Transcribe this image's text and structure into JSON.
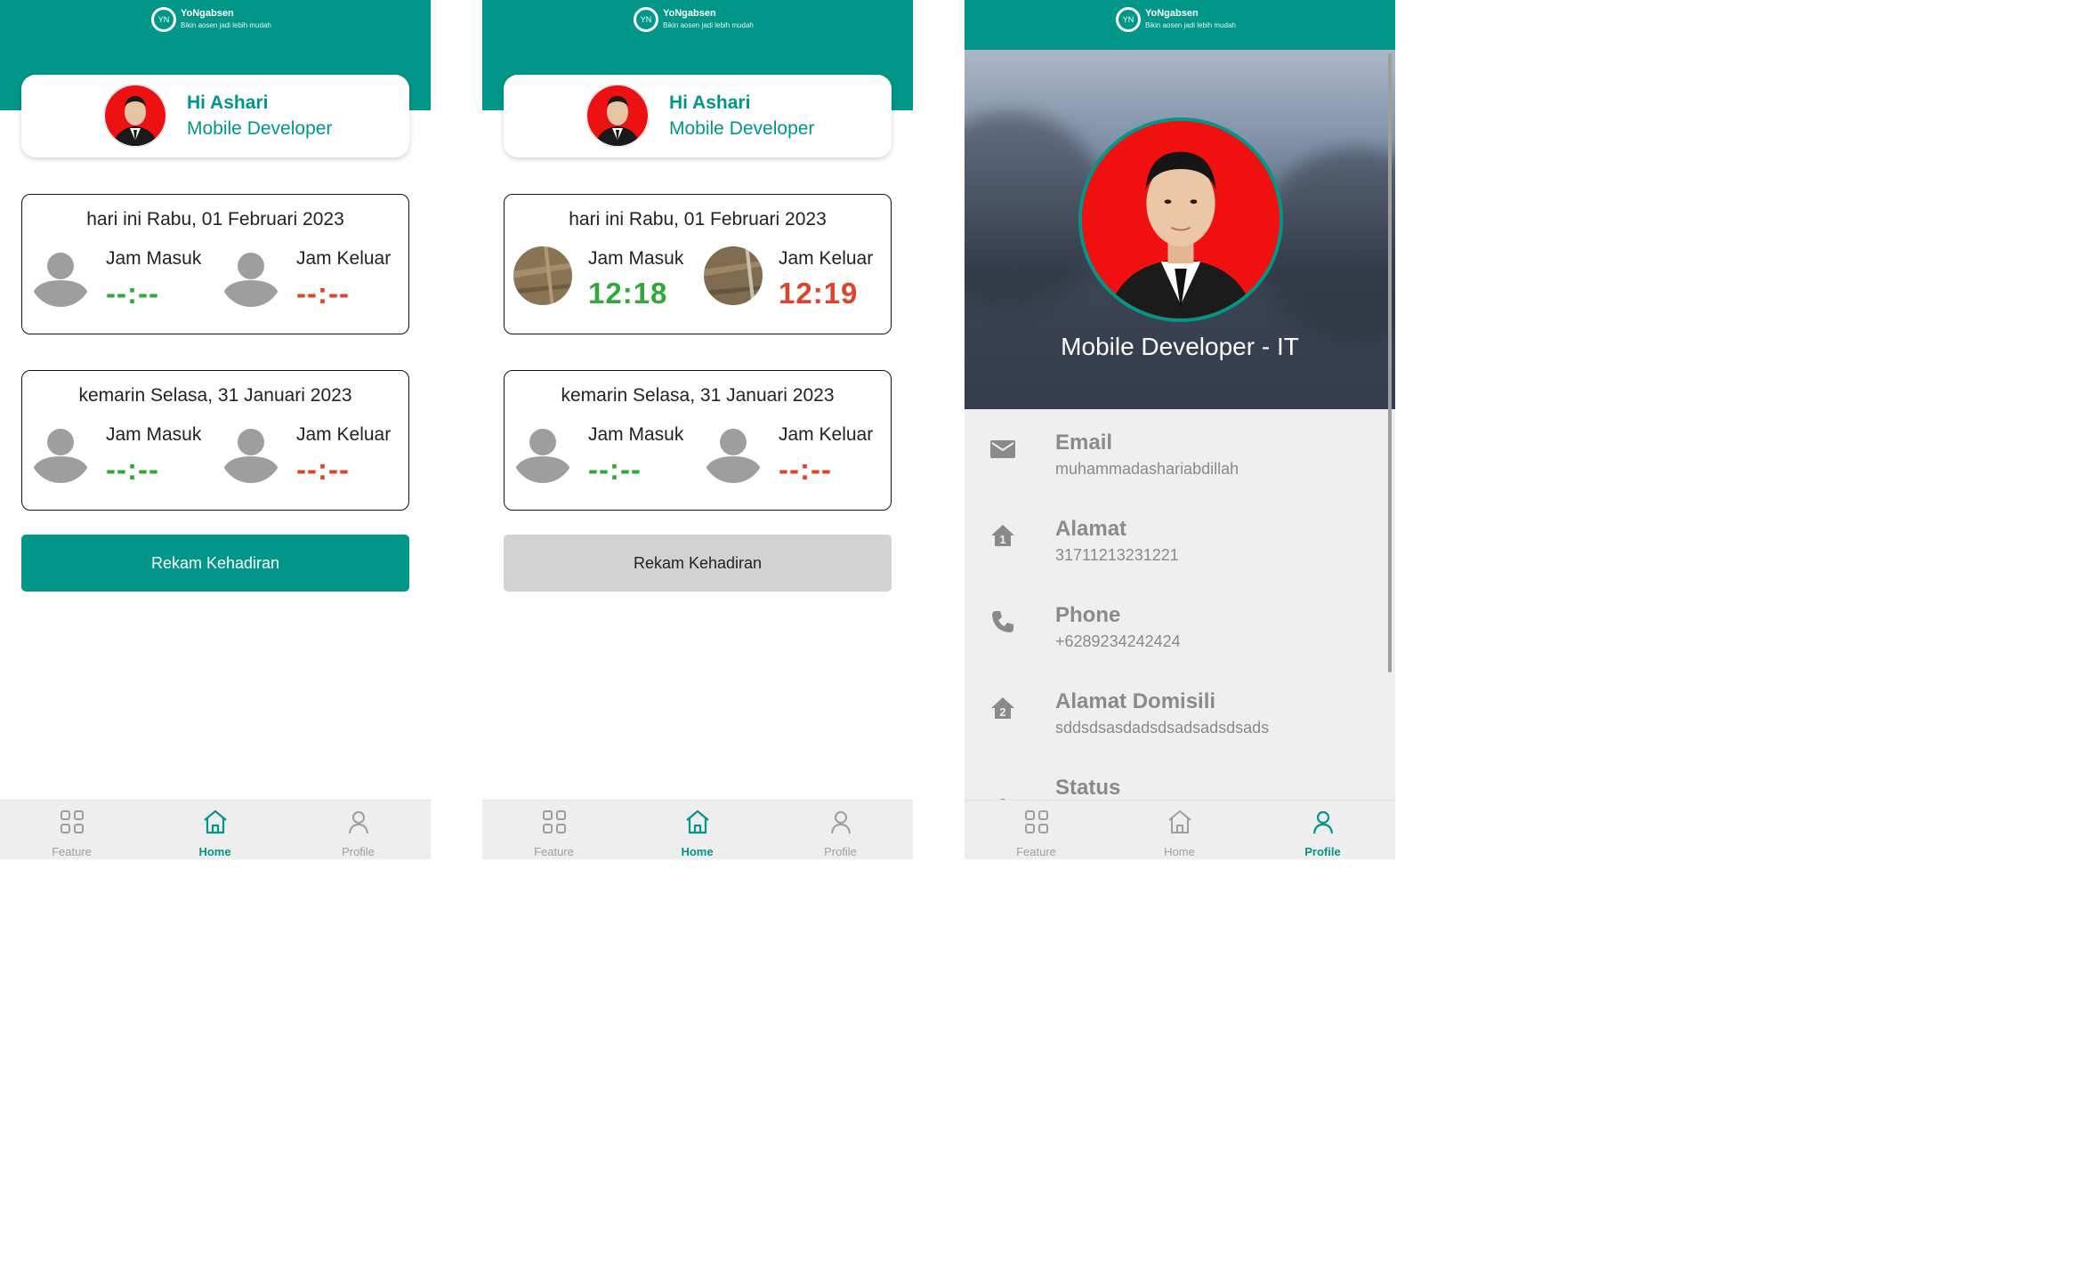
{
  "app": {
    "logo_initials": "YN",
    "name": "YoNgabsen",
    "tagline": "Bikin aosen jadi lebih mudah"
  },
  "colors": {
    "primary": "#009688",
    "time_in": "#2eaa3a",
    "time_out": "#e0432b",
    "disabled_button": "#d2d2d2"
  },
  "user": {
    "greeting": "Hi Ashari",
    "role": "Mobile Developer"
  },
  "nav": {
    "feature": "Feature",
    "home": "Home",
    "profile": "Profile"
  },
  "screens": [
    {
      "today": {
        "date": "hari ini Rabu, 01 Februari 2023",
        "in_label": "Jam Masuk",
        "in_time": "--:--",
        "in_photo": "placeholder-avatar",
        "out_label": "Jam Keluar",
        "out_time": "--:--",
        "out_photo": "placeholder-avatar"
      },
      "yesterday": {
        "date": "kemarin Selasa, 31 Januari 2023",
        "in_label": "Jam Masuk",
        "in_time": "--:--",
        "out_label": "Jam Keluar",
        "out_time": "--:--"
      },
      "record_button": "Rekam Kehadiran",
      "record_button_state": "enabled"
    },
    {
      "today": {
        "date": "hari ini Rabu, 01 Februari 2023",
        "in_label": "Jam Masuk",
        "in_time": "12:18",
        "in_photo": "captured-photo",
        "out_label": "Jam Keluar",
        "out_time": "12:19",
        "out_photo": "captured-photo"
      },
      "yesterday": {
        "date": "kemarin Selasa, 31 Januari 2023",
        "in_label": "Jam Masuk",
        "in_time": "--:--",
        "out_label": "Jam Keluar",
        "out_time": "--:--"
      },
      "record_button": "Rekam Kehadiran",
      "record_button_state": "disabled"
    }
  ],
  "profile": {
    "title": "Mobile Developer - IT",
    "fields": [
      {
        "label": "Email",
        "value": "muhammadashariabdillah",
        "icon": "email-icon"
      },
      {
        "label": "Alamat",
        "value": "31711213231221",
        "icon": "home-1-icon"
      },
      {
        "label": "Phone",
        "value": "+6289234242424",
        "icon": "phone-icon"
      },
      {
        "label": "Alamat Domisili",
        "value": "sddsdsasdadsdsadsadsdsads",
        "icon": "home-2-icon"
      },
      {
        "label": "Status",
        "value": "",
        "icon": "status-dot-icon"
      }
    ]
  }
}
